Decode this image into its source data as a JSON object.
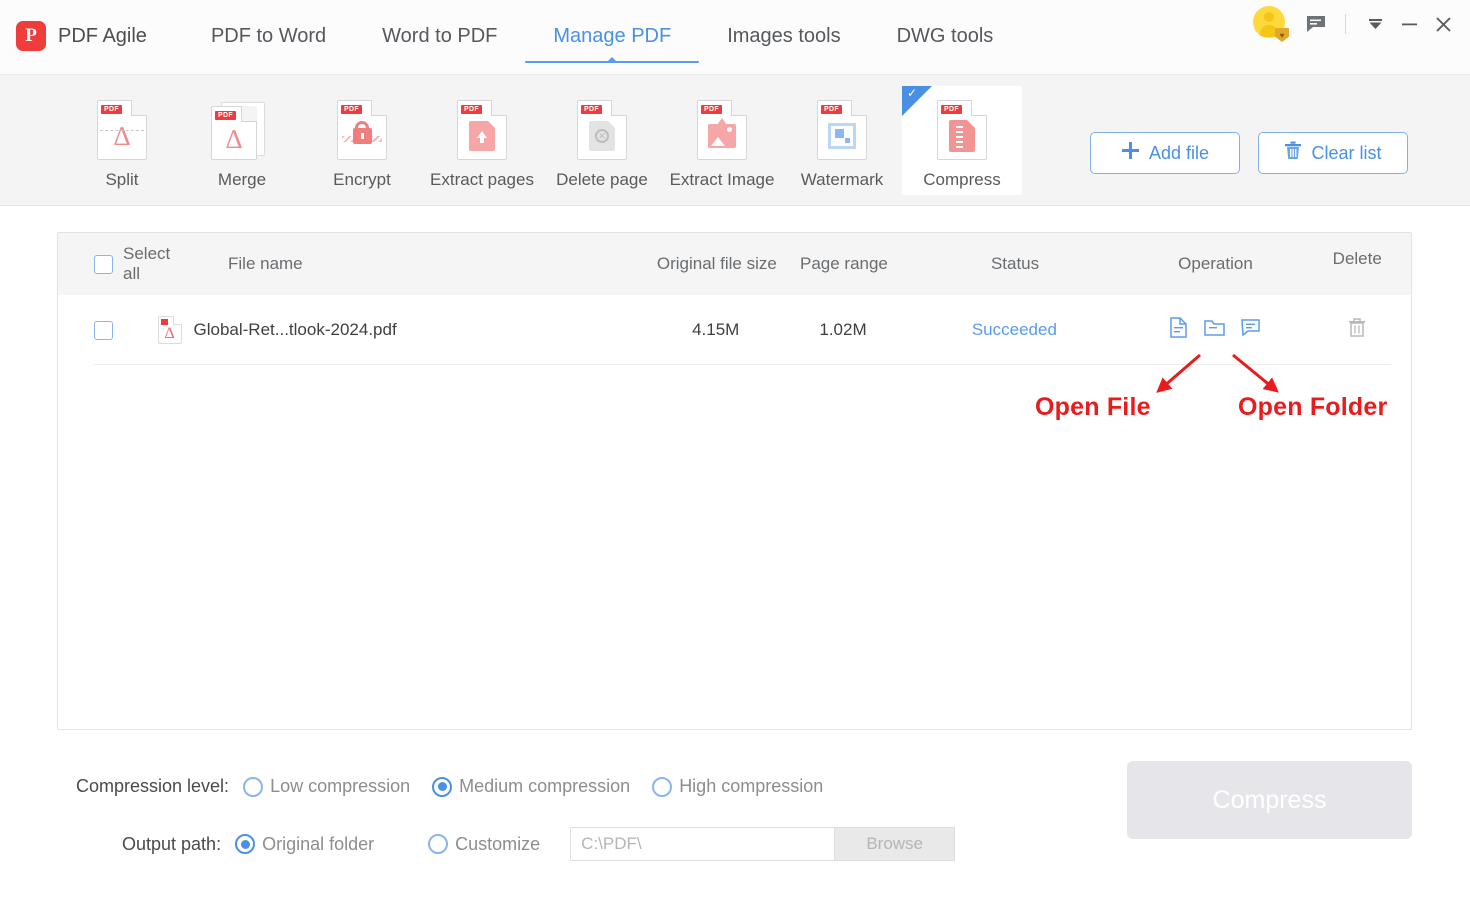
{
  "app": {
    "brand": "PDF Agile",
    "logo_letter": "P",
    "logo_color": "#f13c3c",
    "accent_color": "#4a90e8"
  },
  "nav": {
    "items": [
      {
        "label": "PDF to Word",
        "active": false
      },
      {
        "label": "Word to PDF",
        "active": false
      },
      {
        "label": "Manage PDF",
        "active": true
      },
      {
        "label": "Images tools",
        "active": false
      },
      {
        "label": "DWG tools",
        "active": false
      }
    ]
  },
  "window_controls": {
    "avatar": "user-avatar",
    "message": "message-icon",
    "dropdown": "▼",
    "minimize": "—",
    "close": "✕"
  },
  "toolbar": {
    "tools": [
      {
        "label": "Split",
        "icon": "split-icon",
        "selected": false
      },
      {
        "label": "Merge",
        "icon": "merge-icon",
        "selected": false
      },
      {
        "label": "Encrypt",
        "icon": "encrypt-icon",
        "selected": false
      },
      {
        "label": "Extract pages",
        "icon": "extract-pages-icon",
        "selected": false
      },
      {
        "label": "Delete page",
        "icon": "delete-page-icon",
        "selected": false
      },
      {
        "label": "Extract Image",
        "icon": "extract-image-icon",
        "selected": false
      },
      {
        "label": "Watermark",
        "icon": "watermark-icon",
        "selected": false
      },
      {
        "label": "Compress",
        "icon": "compress-icon",
        "selected": true
      }
    ],
    "add_file_label": "Add file",
    "add_file_icon": "plus-icon",
    "clear_list_label": "Clear list",
    "clear_list_icon": "trash-icon"
  },
  "file_list": {
    "select_all_label": "Select all",
    "columns": {
      "file_name": "File name",
      "original_file_size": "Original file size",
      "page_range": "Page range",
      "status": "Status",
      "operation": "Operation",
      "delete": "Delete"
    },
    "rows": [
      {
        "file_name": "Global-Ret...tlook-2024.pdf",
        "original_file_size": "4.15M",
        "page_range": "1.02M",
        "status": "Succeeded",
        "status_color": "#5b9bee",
        "operations": [
          "open-file-icon",
          "open-folder-icon",
          "feedback-icon"
        ],
        "delete_icon": "trash-icon"
      }
    ]
  },
  "annotations": [
    {
      "text": "Open File",
      "color": "#e81c1c"
    },
    {
      "text": "Open Folder",
      "color": "#e81c1c"
    }
  ],
  "settings": {
    "compression_level_label": "Compression level:",
    "compression_options": [
      {
        "label": "Low compression",
        "selected": false
      },
      {
        "label": "Medium compression",
        "selected": true
      },
      {
        "label": "High compression",
        "selected": false
      }
    ],
    "output_path_label": "Output path:",
    "output_options": [
      {
        "label": "Original folder",
        "selected": true
      },
      {
        "label": "Customize",
        "selected": false
      }
    ],
    "path_value": "C:\\PDF\\",
    "browse_label": "Browse",
    "compress_button_label": "Compress"
  }
}
